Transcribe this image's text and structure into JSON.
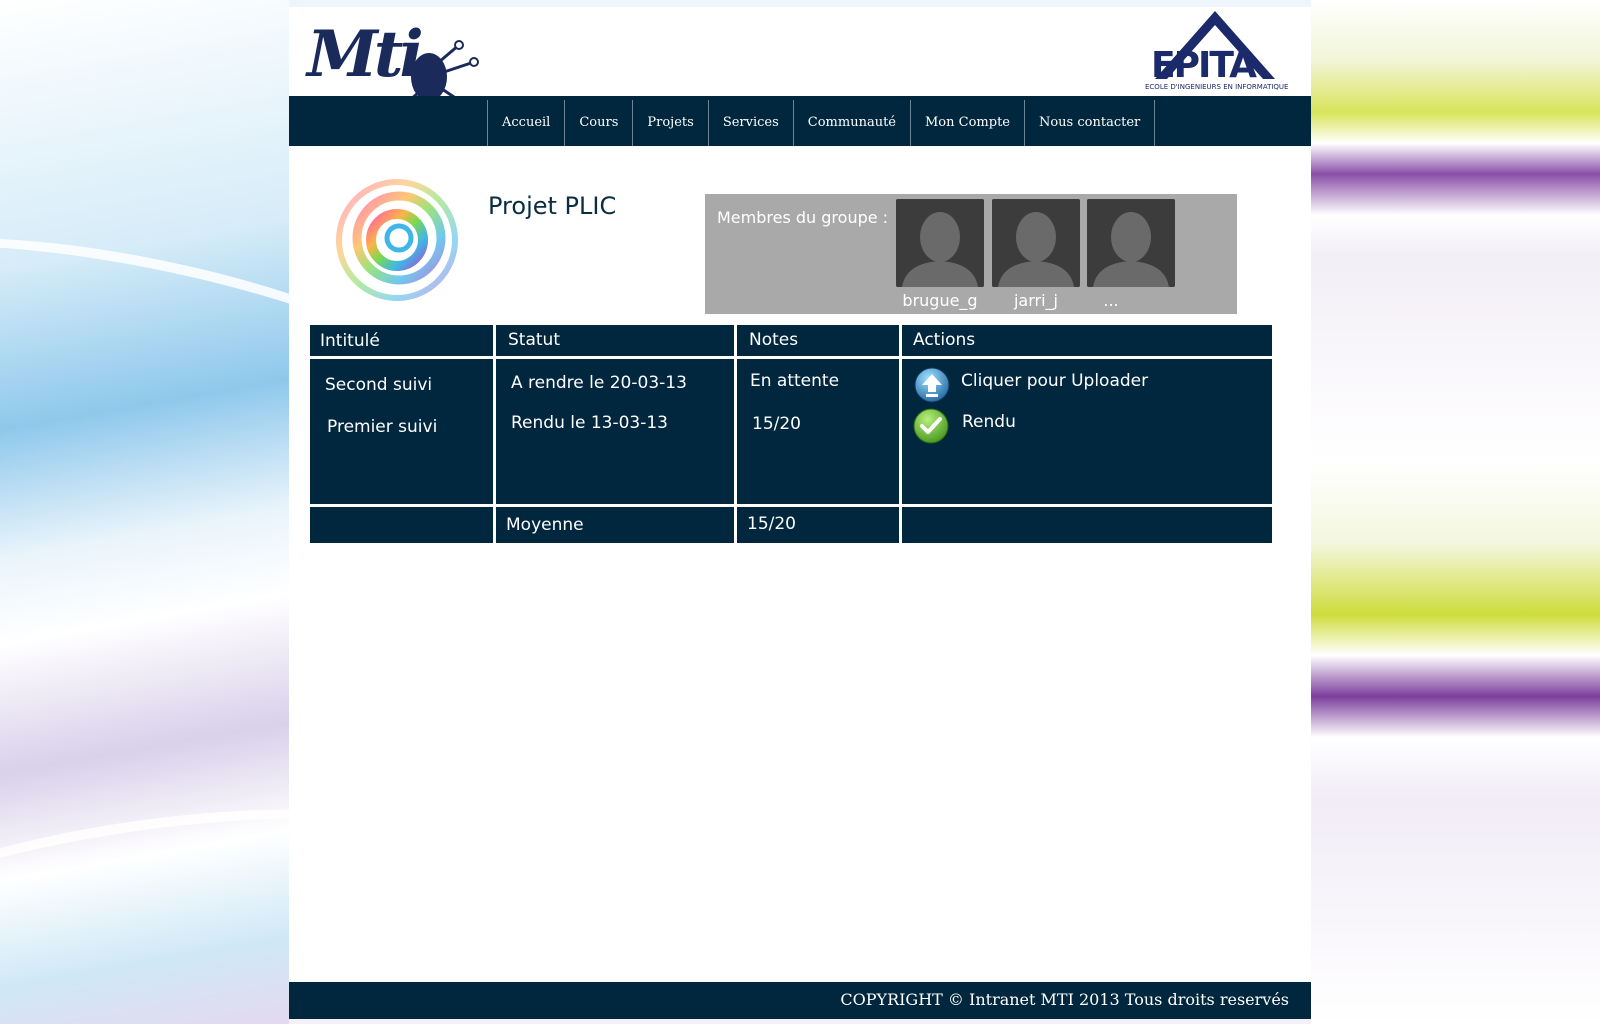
{
  "brand": {
    "mti_logo": "Mti",
    "epita_logo": "EPITA",
    "epita_subtitle": "ECOLE D'INGENIEURS EN INFORMATIQUE"
  },
  "nav": {
    "items": [
      {
        "label": "Accueil"
      },
      {
        "label": "Cours"
      },
      {
        "label": "Projets"
      },
      {
        "label": "Services"
      },
      {
        "label": "Communauté"
      },
      {
        "label": "Mon Compte"
      },
      {
        "label": "Nous contacter"
      }
    ]
  },
  "project": {
    "title": "Projet PLIC"
  },
  "members": {
    "label": "Membres du groupe :",
    "list": [
      {
        "name": "brugue_g"
      },
      {
        "name": "jarri_j"
      },
      {
        "name": "..."
      }
    ]
  },
  "table": {
    "headers": {
      "intitule": "Intitulé",
      "statut": "Statut",
      "notes": "Notes",
      "actions": "Actions"
    },
    "rows": [
      {
        "intitule": "Second suivi",
        "statut": "A rendre le 20-03-13",
        "note": "En attente",
        "action": "Cliquer pour Uploader",
        "action_icon": "upload-icon"
      },
      {
        "intitule": "Premier suivi",
        "statut": "Rendu le 13-03-13",
        "note": "15/20",
        "action": "Rendu",
        "action_icon": "check-icon"
      }
    ],
    "average": {
      "label": "Moyenne",
      "value": "15/20"
    }
  },
  "footer": {
    "copyright": "COPYRIGHT © Intranet MTI 2013 Tous droits reservés"
  },
  "colors": {
    "primary": "#00273d",
    "members_bg": "#a9a9a9"
  }
}
